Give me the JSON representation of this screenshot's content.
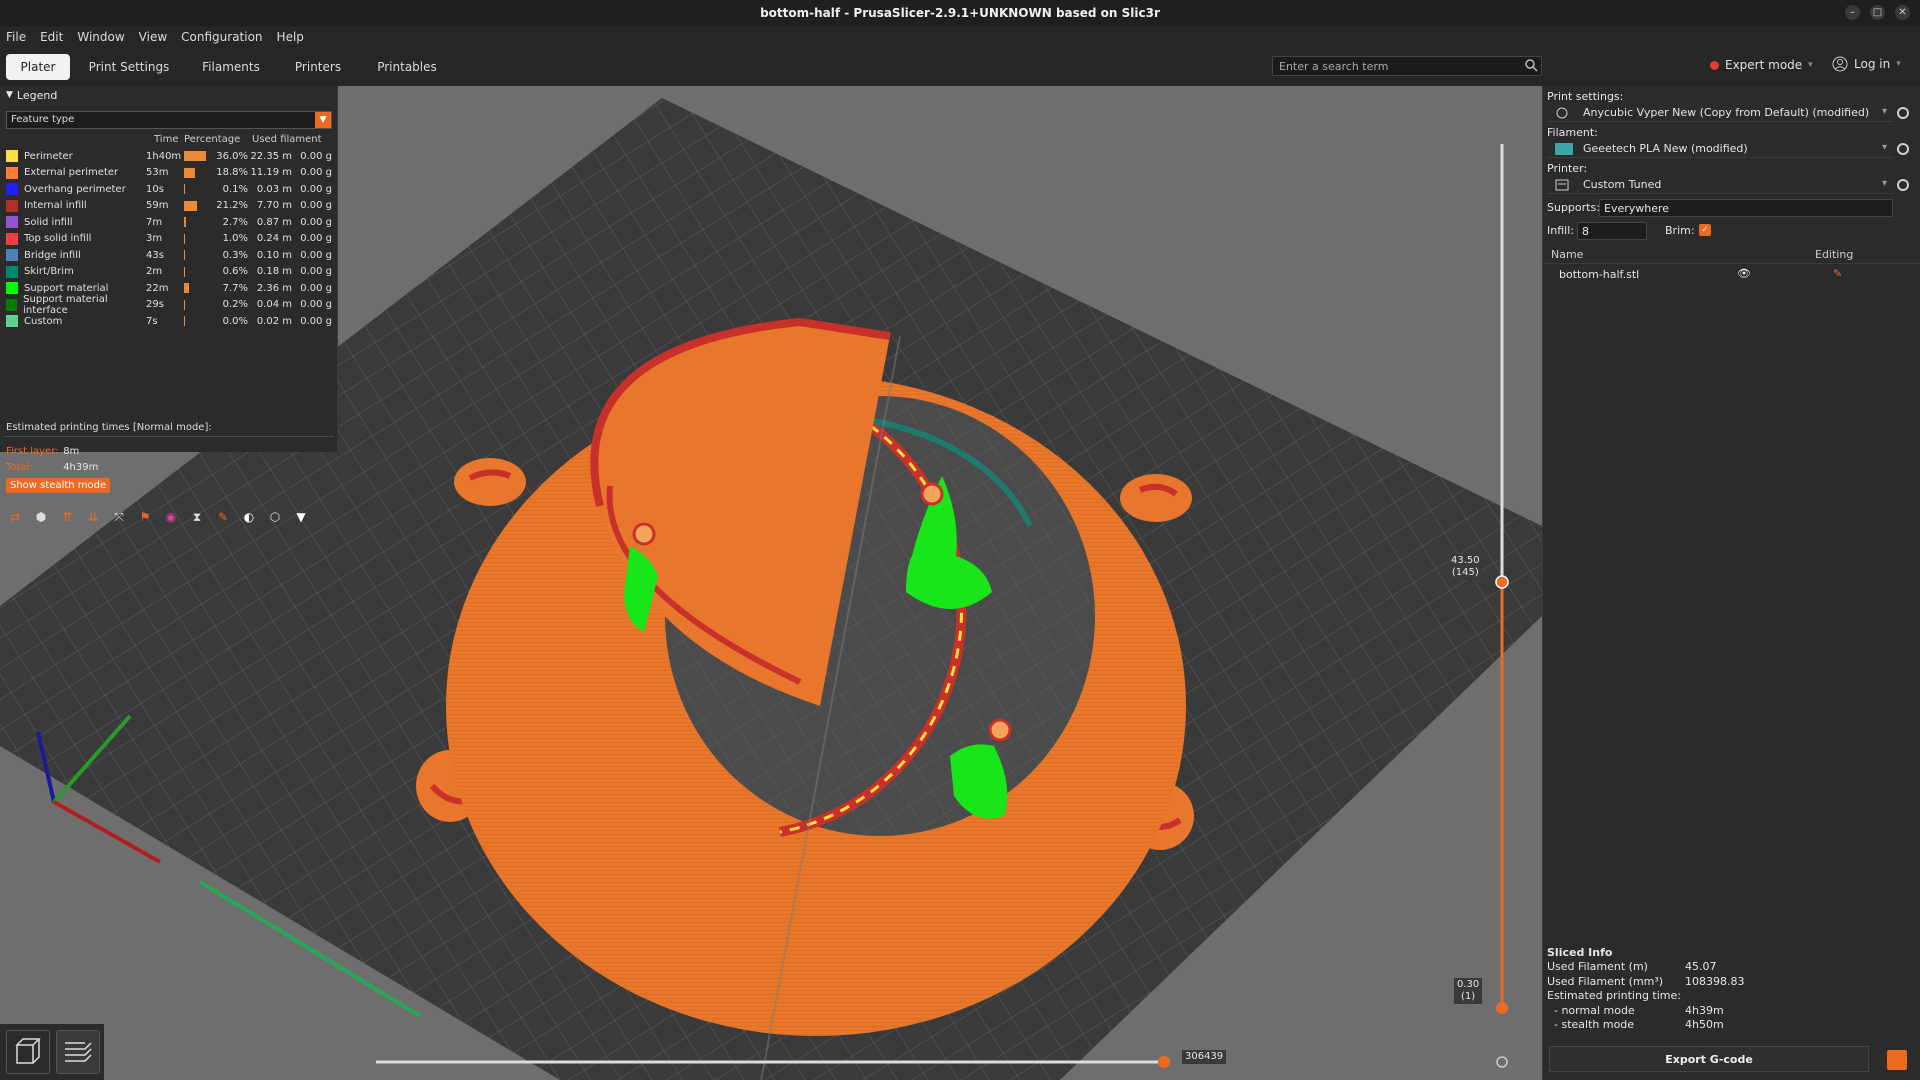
{
  "window": {
    "title": "bottom-half - PrusaSlicer-2.9.1+UNKNOWN based on Slic3r"
  },
  "menu": [
    "File",
    "Edit",
    "Window",
    "View",
    "Configuration",
    "Help"
  ],
  "tabs": [
    "Plater",
    "Print Settings",
    "Filaments",
    "Printers",
    "Printables"
  ],
  "search": {
    "placeholder": "Enter a search term"
  },
  "mode": {
    "label": "Expert mode"
  },
  "login": {
    "label": "Log in"
  },
  "legend": {
    "title": "Legend",
    "view_type": "Feature type",
    "columns": {
      "time": "Time",
      "percentage": "Percentage",
      "used": "Used filament"
    },
    "rows": [
      {
        "name": "Perimeter",
        "time": "1h40m",
        "pct": "36.0%",
        "len": "22.35 m",
        "g": "0.00 g",
        "color": "#ffe040",
        "fill": 0.36
      },
      {
        "name": "External perimeter",
        "time": "53m",
        "pct": "18.8%",
        "len": "11.19 m",
        "g": "0.00 g",
        "color": "#ff7d38",
        "fill": 0.188
      },
      {
        "name": "Overhang perimeter",
        "time": "10s",
        "pct": "0.1%",
        "len": "0.03 m",
        "g": "0.00 g",
        "color": "#1f1fff",
        "fill": 0.001
      },
      {
        "name": "Internal infill",
        "time": "59m",
        "pct": "21.2%",
        "len": "7.70 m",
        "g": "0.00 g",
        "color": "#b03029",
        "fill": 0.212
      },
      {
        "name": "Solid infill",
        "time": "7m",
        "pct": "2.7%",
        "len": "0.87 m",
        "g": "0.00 g",
        "color": "#9654cc",
        "fill": 0.027
      },
      {
        "name": "Top solid infill",
        "time": "3m",
        "pct": "1.0%",
        "len": "0.24 m",
        "g": "0.00 g",
        "color": "#f04040",
        "fill": 0.01
      },
      {
        "name": "Bridge infill",
        "time": "43s",
        "pct": "0.3%",
        "len": "0.10 m",
        "g": "0.00 g",
        "color": "#4d80ba",
        "fill": 0.003
      },
      {
        "name": "Skirt/Brim",
        "time": "2m",
        "pct": "0.6%",
        "len": "0.18 m",
        "g": "0.00 g",
        "color": "#00876e",
        "fill": 0.006
      },
      {
        "name": "Support material",
        "time": "22m",
        "pct": "7.7%",
        "len": "2.36 m",
        "g": "0.00 g",
        "color": "#00ff00",
        "fill": 0.077
      },
      {
        "name": "Support material interface",
        "time": "29s",
        "pct": "0.2%",
        "len": "0.04 m",
        "g": "0.00 g",
        "color": "#008000",
        "fill": 0.002
      },
      {
        "name": "Custom",
        "time": "7s",
        "pct": "0.0%",
        "len": "0.02 m",
        "g": "0.00 g",
        "color": "#5ed194",
        "fill": 0.0
      }
    ],
    "estimated_title": "Estimated printing times [Normal mode]:",
    "first_layer_label": "First layer:",
    "first_layer": "8m",
    "total_label": "Total:",
    "total": "4h39m",
    "stealth_button": "Show stealth mode"
  },
  "right": {
    "print_settings_label": "Print settings:",
    "print_settings": "Anycubic Vyper New (Copy from Default) (modified)",
    "filament_label": "Filament:",
    "filament": "Geeetech PLA New (modified)",
    "filament_color": "#3aa6a6",
    "printer_label": "Printer:",
    "printer": "Custom Tuned",
    "supports_label": "Supports:",
    "supports": "Everywhere",
    "infill_label": "Infill:",
    "infill": "8",
    "brim_label": "Brim:",
    "objects_col_name": "Name",
    "objects_col_editing": "Editing",
    "object_name": "bottom-half.stl"
  },
  "sliced": {
    "title": "Sliced Info",
    "rows": [
      {
        "k": "Used Filament (m)",
        "v": "45.07"
      },
      {
        "k": "Used Filament (mm³)",
        "v": "108398.83"
      },
      {
        "k": "Estimated printing time:",
        "v": ""
      },
      {
        "k": "  - normal mode",
        "v": "4h39m"
      },
      {
        "k": "  - stealth mode",
        "v": "4h50m"
      }
    ],
    "export_button": "Export G-code"
  },
  "sliders": {
    "vertical_top_value": "43.50",
    "vertical_top_layer": "(145)",
    "vertical_bottom_value": "0.30",
    "vertical_bottom_layer": "(1)",
    "horizontal_value": "306439"
  },
  "colors": {
    "accent": "#ed6b21",
    "model": "#e8762c"
  }
}
